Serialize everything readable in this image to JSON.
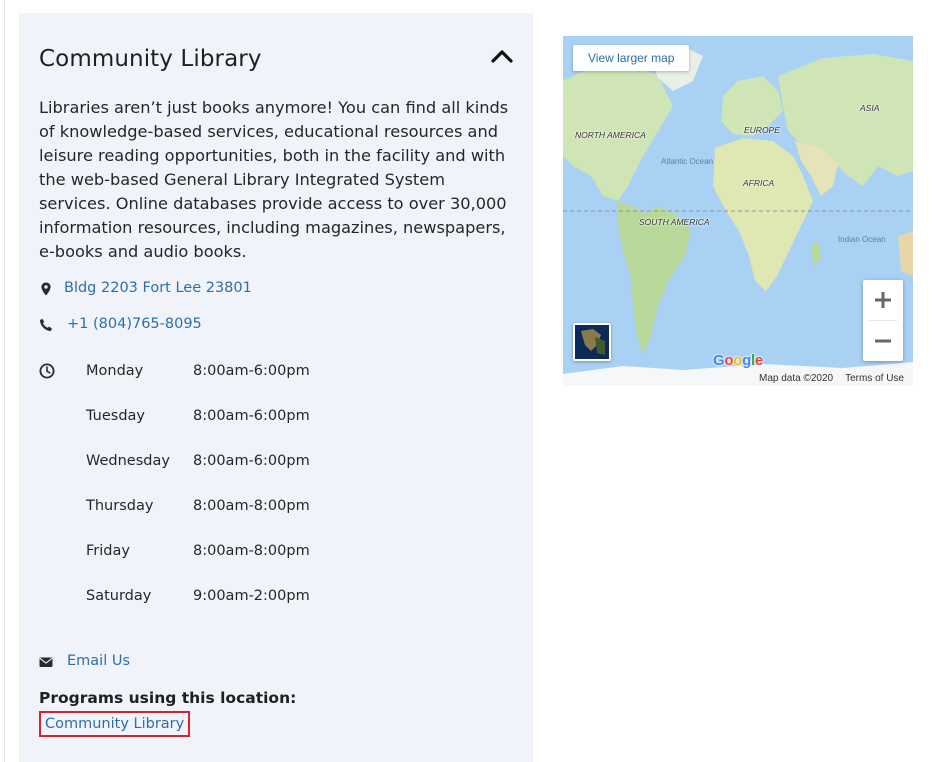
{
  "location": {
    "title": "Community Library",
    "description": "Libraries aren’t just books anymore! You can find all kinds of knowledge-based services, educational resources and leisure reading opportunities, both in the facility and with the web-based General Library Integrated System services. Online databases provide access to over 30,000 information resources, including magazines, newspapers, e-books and audio books.",
    "address": "Bldg 2203 Fort Lee 23801",
    "phone": "+1 (804)765-8095",
    "hours": [
      {
        "day": "Monday",
        "time": "8:00am-6:00pm"
      },
      {
        "day": "Tuesday",
        "time": "8:00am-6:00pm"
      },
      {
        "day": "Wednesday",
        "time": "8:00am-6:00pm"
      },
      {
        "day": "Thursday",
        "time": "8:00am-8:00pm"
      },
      {
        "day": "Friday",
        "time": "8:00am-8:00pm"
      },
      {
        "day": "Saturday",
        "time": "9:00am-2:00pm"
      }
    ],
    "email_label": "Email Us",
    "programs_heading": "Programs using this location:",
    "programs": [
      "Community Library"
    ]
  },
  "map": {
    "larger_map_label": "View larger map",
    "attribution": "Map data ©2020",
    "terms": "Terms of Use",
    "logo": "Google",
    "labels": {
      "north_america": "NORTH AMERICA",
      "europe": "EUROPE",
      "asia": "ASIA",
      "africa": "AFRICA",
      "south_america": "SOUTH AMERICA",
      "atlantic": "Atlantic Ocean",
      "indian": "Indian Ocean"
    },
    "icons": {
      "zoom_in": "plus-icon",
      "zoom_out": "minus-icon",
      "satellite": "satellite-thumbnail"
    }
  },
  "icons": {
    "collapse": "chevron-up-icon",
    "address": "map-pin-icon",
    "phone": "phone-icon",
    "hours": "clock-icon",
    "email": "envelope-icon"
  },
  "colors": {
    "link": "#2f6ea8",
    "card_background": "#f0f4fa",
    "highlight_border": "#d8232a",
    "water": "#a9d1f3",
    "land": "#cfe5b6"
  }
}
